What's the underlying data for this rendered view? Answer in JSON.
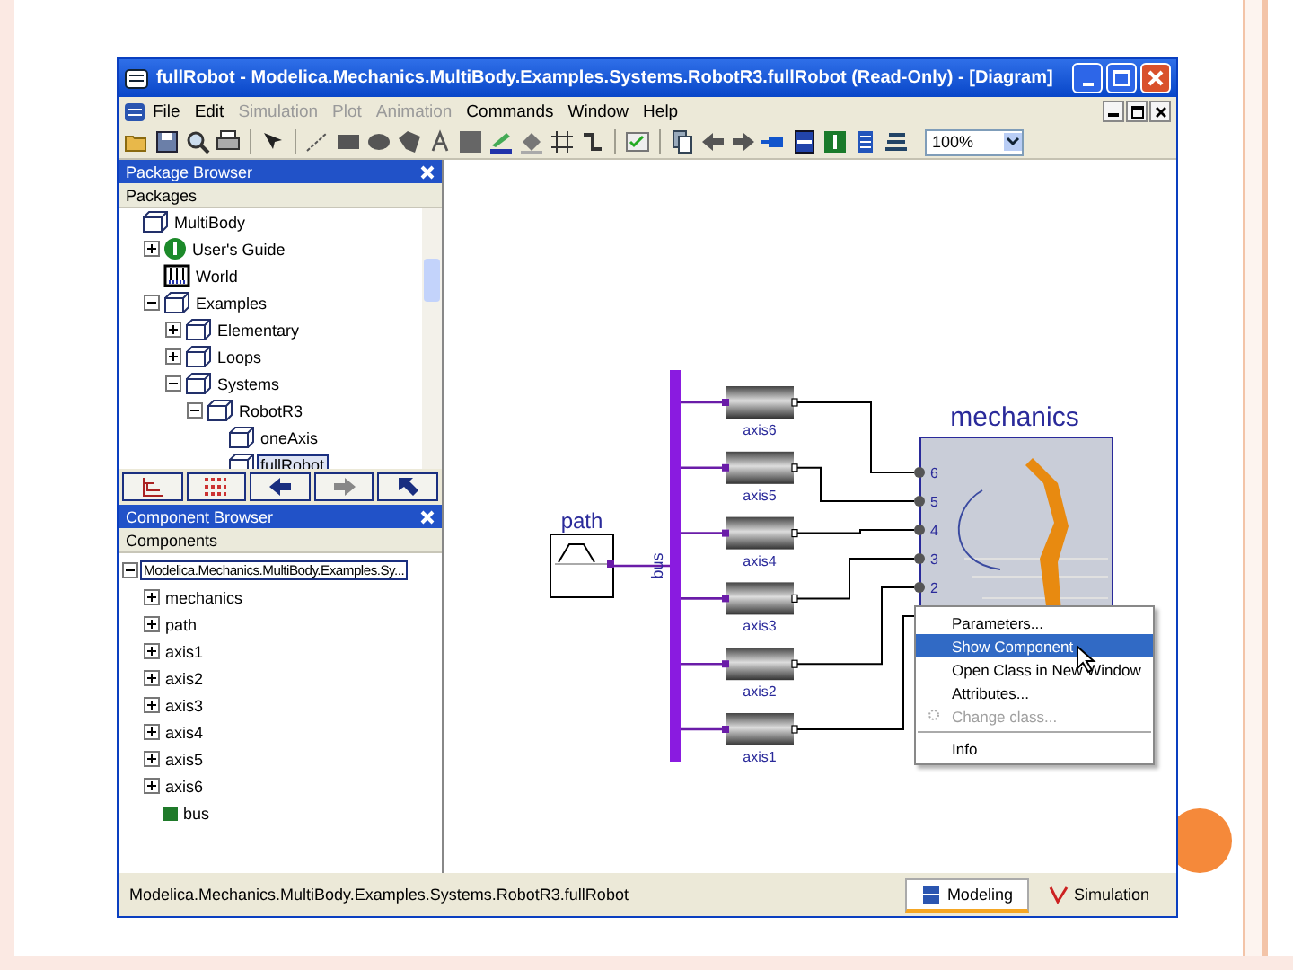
{
  "window": {
    "title": "fullRobot - Modelica.Mechanics.MultiBody.Examples.Systems.RobotR3.fullRobot  (Read-Only) - [Diagram]"
  },
  "menu": [
    {
      "label": "File",
      "disabled": false
    },
    {
      "label": "Edit",
      "disabled": false
    },
    {
      "label": "Simulation",
      "disabled": true
    },
    {
      "label": "Plot",
      "disabled": true
    },
    {
      "label": "Animation",
      "disabled": true
    },
    {
      "label": "Commands",
      "disabled": false
    },
    {
      "label": "Window",
      "disabled": false
    },
    {
      "label": "Help",
      "disabled": false
    }
  ],
  "toolbar": {
    "zoom": "100%"
  },
  "package_browser": {
    "title": "Package Browser",
    "column": "Packages",
    "items": [
      {
        "label": "MultiBody",
        "kind": "package",
        "selected": false,
        "children": [
          {
            "label": "User's Guide",
            "kind": "info",
            "selected": false,
            "expanded": false
          },
          {
            "label": "World",
            "kind": "world",
            "selected": false
          },
          {
            "label": "Examples",
            "kind": "package",
            "selected": false,
            "expanded": true,
            "children": [
              {
                "label": "Elementary",
                "kind": "package",
                "selected": false,
                "expanded": false
              },
              {
                "label": "Loops",
                "kind": "package",
                "selected": false,
                "expanded": false
              },
              {
                "label": "Systems",
                "kind": "package",
                "selected": false,
                "expanded": true,
                "children": [
                  {
                    "label": "RobotR3",
                    "kind": "package",
                    "selected": false,
                    "expanded": true,
                    "children": [
                      {
                        "label": "oneAxis",
                        "kind": "model",
                        "selected": false
                      },
                      {
                        "label": "fullRobot",
                        "kind": "model",
                        "selected": true
                      }
                    ]
                  }
                ]
              }
            ]
          }
        ]
      }
    ]
  },
  "component_browser": {
    "title": "Component Browser",
    "column": "Components",
    "items": [
      {
        "label": "Modelica.Mechanics.MultiBody.Examples.Sy...",
        "kind": "class",
        "selected": true,
        "expanded": true,
        "children": [
          {
            "label": "mechanics",
            "kind": "component",
            "selected": false,
            "expanded": false
          },
          {
            "label": "path",
            "kind": "component",
            "selected": false,
            "expanded": false
          },
          {
            "label": "axis1",
            "kind": "component",
            "selected": false,
            "expanded": false
          },
          {
            "label": "axis2",
            "kind": "component",
            "selected": false,
            "expanded": false
          },
          {
            "label": "axis3",
            "kind": "component",
            "selected": false,
            "expanded": false
          },
          {
            "label": "axis4",
            "kind": "component",
            "selected": false,
            "expanded": false
          },
          {
            "label": "axis5",
            "kind": "component",
            "selected": false,
            "expanded": false
          },
          {
            "label": "axis6",
            "kind": "component",
            "selected": false,
            "expanded": false
          },
          {
            "label": "bus",
            "kind": "bus",
            "selected": false
          }
        ]
      }
    ]
  },
  "diagram": {
    "source": {
      "label": "path"
    },
    "bus": {
      "label": "bus"
    },
    "axes": [
      {
        "label": "axis6"
      },
      {
        "label": "axis5"
      },
      {
        "label": "axis4"
      },
      {
        "label": "axis3"
      },
      {
        "label": "axis2"
      },
      {
        "label": "axis1"
      }
    ],
    "robot": {
      "label": "mechanics",
      "ports": [
        "6",
        "5",
        "4",
        "3",
        "2"
      ]
    }
  },
  "context_menu": [
    {
      "kind": "item",
      "label": "Parameters...",
      "selected": false,
      "disabled": false
    },
    {
      "kind": "item",
      "label": "Show Component",
      "selected": true,
      "disabled": false
    },
    {
      "kind": "item",
      "label": "Open Class in New Window",
      "selected": false,
      "disabled": false
    },
    {
      "kind": "item",
      "label": "Attributes...",
      "selected": false,
      "disabled": false
    },
    {
      "kind": "item",
      "label": "Change class...",
      "selected": false,
      "disabled": true
    },
    {
      "kind": "separator"
    },
    {
      "kind": "item",
      "label": "Info",
      "selected": false,
      "disabled": false
    }
  ],
  "status_bar": {
    "text": "Modelica.Mechanics.MultiBody.Examples.Systems.RobotR3.fullRobot",
    "tabs": [
      {
        "label": "Modeling",
        "selected": true
      },
      {
        "label": "Simulation",
        "selected": false
      }
    ]
  }
}
